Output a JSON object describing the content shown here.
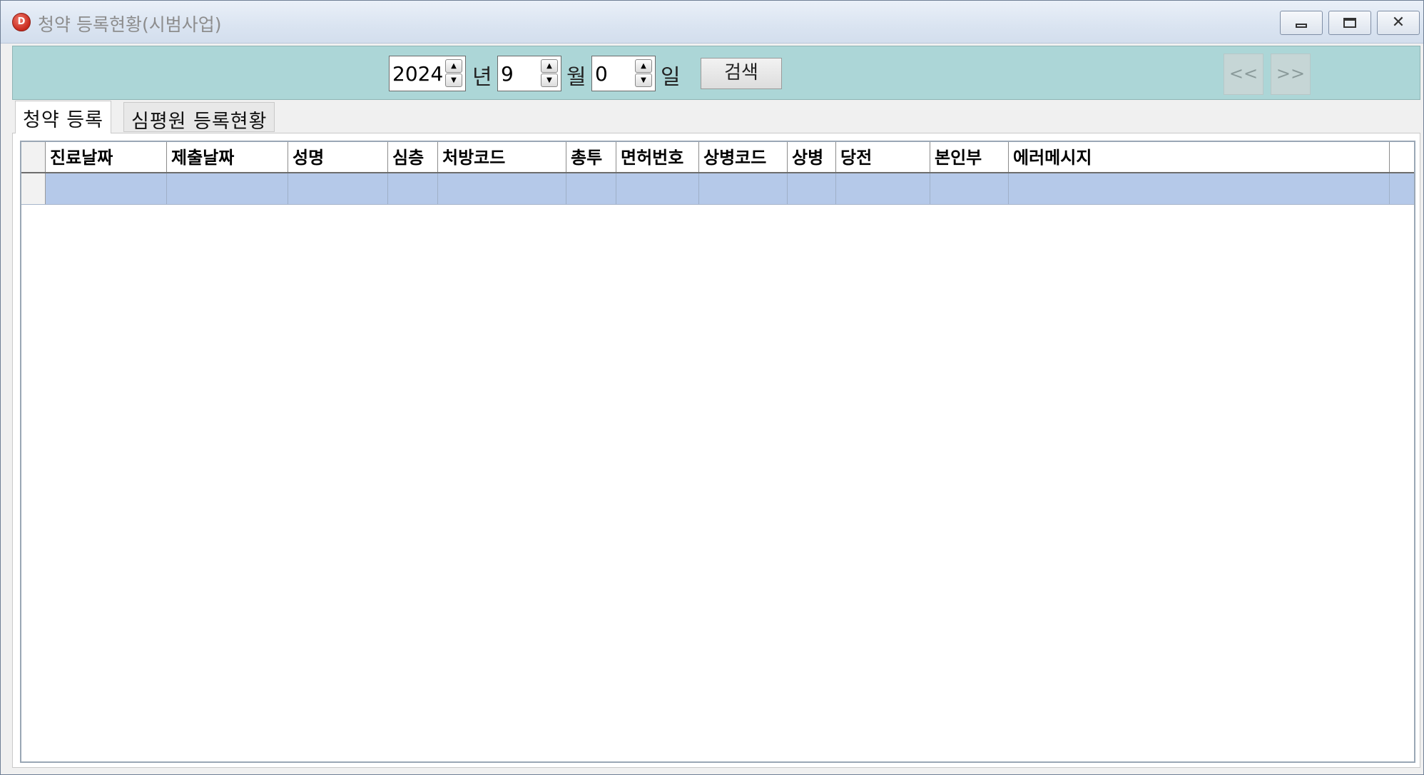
{
  "window": {
    "title": "청약 등록현황(시범사업)",
    "app_icon_letter": "D"
  },
  "search": {
    "year_value": "2024",
    "year_unit": "년",
    "month_value": "9",
    "month_unit": "월",
    "day_value": "0",
    "day_unit": "일",
    "search_label": "검색",
    "prev_label": "<<",
    "next_label": ">>"
  },
  "tabs": [
    {
      "label": "청약 등록",
      "active": true
    },
    {
      "label": "심평원 등록현황",
      "active": false
    }
  ],
  "grid": {
    "columns": [
      "진료날짜",
      "제출날짜",
      "성명",
      "심층",
      "처방코드",
      "총투",
      "면허번호",
      "상병코드",
      "상병",
      "당전",
      "본인부",
      "에러메시지"
    ],
    "rows": [
      [
        "",
        "",
        "",
        "",
        "",
        "",
        "",
        "",
        "",
        "",
        "",
        ""
      ]
    ]
  },
  "colors": {
    "search_bar": "#acd6d7",
    "selected_row": "#b5c9e9",
    "close_button_icon": "#c8281c"
  }
}
